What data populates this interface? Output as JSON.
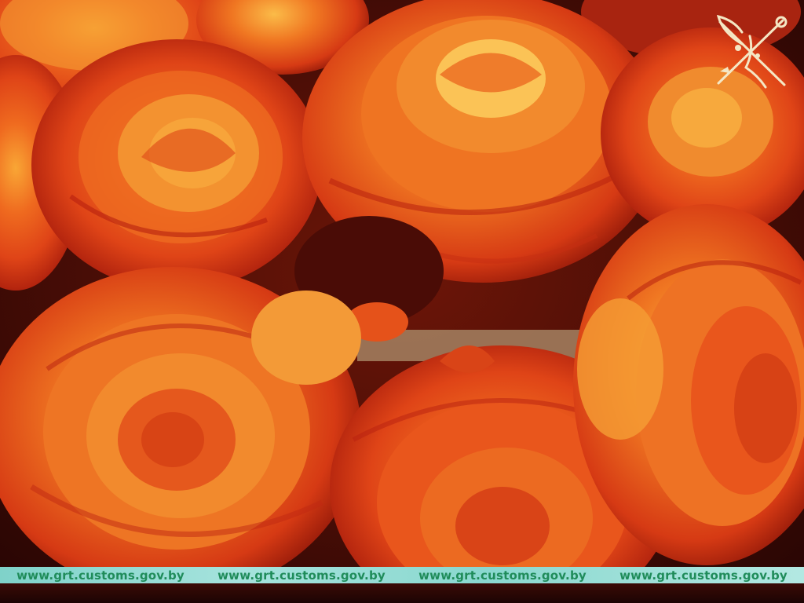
{
  "colors": {
    "petal_deep": "#b8200f",
    "petal_mid": "#e8501a",
    "petal_light": "#f7a43a",
    "petal_core": "#fbd16a",
    "shadow": "#3a0905",
    "strip_bg": "#9fe0d9",
    "strip_text": "#1f8c5a"
  },
  "watermark": {
    "emblem_icon": "customs-emblem-icon",
    "urls": [
      "www.grt.customs.gov.by",
      "www.grt.customs.gov.by",
      "www.grt.customs.gov.by",
      "www.grt.customs.gov.by"
    ]
  }
}
